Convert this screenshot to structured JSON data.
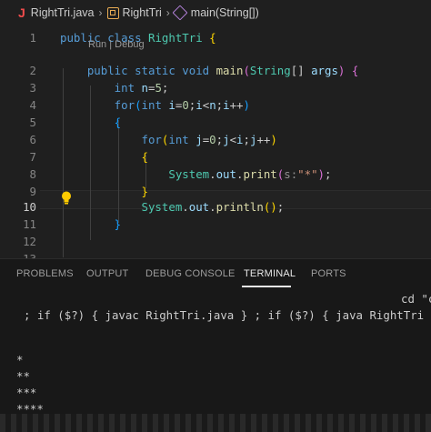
{
  "breadcrumb": {
    "file": "RightTri.java",
    "class_name": "RightTri",
    "method": "main(String[])",
    "file_icon_letter": "J"
  },
  "editor": {
    "codelens": "Run | Debug",
    "lines": [
      {
        "n": "1",
        "tokens": [
          [
            "kw",
            "public"
          ],
          [
            "",
            ""
          ],
          [
            "kw",
            " class"
          ],
          [
            "ty",
            " RightTri"
          ],
          [
            "pn",
            " {"
          ]
        ]
      },
      {
        "n": "2",
        "tokens": [
          [
            "kw",
            "    public"
          ],
          [
            "kw",
            " static"
          ],
          [
            "kw",
            " void"
          ],
          [
            "fn",
            " main"
          ],
          [
            "pn2",
            "("
          ],
          [
            "ty",
            "String"
          ],
          [
            "",
            "[] "
          ],
          [
            "vr",
            "args"
          ],
          [
            "pn2",
            ")"
          ],
          [
            "pn2",
            " {"
          ]
        ]
      },
      {
        "n": "3",
        "tokens": [
          [
            "kw",
            "        int"
          ],
          [
            "vr",
            " n"
          ],
          [
            "",
            "="
          ],
          [
            "nm",
            "5"
          ],
          [
            "",
            ";"
          ]
        ]
      },
      {
        "n": "4",
        "tokens": [
          [
            "kw",
            "        for"
          ],
          [
            "pn3",
            "("
          ],
          [
            "kw",
            "int"
          ],
          [
            "vr",
            " i"
          ],
          [
            "",
            "="
          ],
          [
            "nm",
            "0"
          ],
          [
            "",
            ";"
          ],
          [
            "vr",
            "i"
          ],
          [
            "",
            "<"
          ],
          [
            "vr",
            "n"
          ],
          [
            "",
            ";"
          ],
          [
            "vr",
            "i"
          ],
          [
            "",
            "++"
          ],
          [
            "pn3",
            ")"
          ]
        ]
      },
      {
        "n": "5",
        "tokens": [
          [
            "pn3",
            "        {"
          ]
        ]
      },
      {
        "n": "6",
        "tokens": [
          [
            "kw",
            "            for"
          ],
          [
            "pn",
            "("
          ],
          [
            "kw",
            "int"
          ],
          [
            "vr",
            " j"
          ],
          [
            "",
            "="
          ],
          [
            "nm",
            "0"
          ],
          [
            "",
            ";"
          ],
          [
            "vr",
            "j"
          ],
          [
            "",
            "<"
          ],
          [
            "vr",
            "i"
          ],
          [
            "",
            ";"
          ],
          [
            "vr",
            "j"
          ],
          [
            "",
            "++"
          ],
          [
            "pn",
            ")"
          ]
        ]
      },
      {
        "n": "7",
        "tokens": [
          [
            "pn",
            "            {"
          ]
        ]
      },
      {
        "n": "8",
        "tokens": [
          [
            "ty",
            "                System"
          ],
          [
            "",
            "."
          ],
          [
            "vr",
            "out"
          ],
          [
            "",
            "."
          ],
          [
            "fn",
            "print"
          ],
          [
            "pn2",
            "("
          ],
          [
            "hint",
            "s:"
          ],
          [
            "st",
            "\"*\""
          ],
          [
            "pn2",
            ")"
          ],
          [
            "",
            ";"
          ]
        ]
      },
      {
        "n": "9",
        "tokens": [
          [
            "pn",
            "            }"
          ]
        ]
      },
      {
        "n": "10",
        "tokens": [
          [
            "ty",
            "            System"
          ],
          [
            "",
            "."
          ],
          [
            "vr",
            "out"
          ],
          [
            "",
            "."
          ],
          [
            "fn",
            "println"
          ],
          [
            "pn",
            "()"
          ],
          [
            "",
            ";"
          ]
        ]
      },
      {
        "n": "11",
        "tokens": [
          [
            "pn3",
            "        }"
          ]
        ]
      },
      {
        "n": "12",
        "tokens": []
      },
      {
        "n": "13",
        "tokens": []
      }
    ]
  },
  "panel": {
    "tabs": [
      "PROBLEMS",
      "OUTPUT",
      "DEBUG CONSOLE",
      "TERMINAL",
      "PORTS"
    ],
    "active_tab": "TERMINAL"
  },
  "terminal": {
    "line1": "cd \"c",
    "line2": "; if ($?) { javac RightTri.java } ; if ($?) { java RightTri }",
    "output": [
      "*",
      "**",
      "***",
      "****"
    ]
  },
  "colors": {
    "keyword": "#569cd6",
    "type": "#4ec9b0",
    "function": "#dcdcaa",
    "variable": "#9cdcfe",
    "number": "#b5cea8",
    "string": "#ce9178",
    "java_icon": "#f14c4c"
  },
  "icons": [
    "java-file-icon",
    "chevron-right-icon",
    "class-icon",
    "method-cube-icon",
    "lightbulb-icon"
  ]
}
